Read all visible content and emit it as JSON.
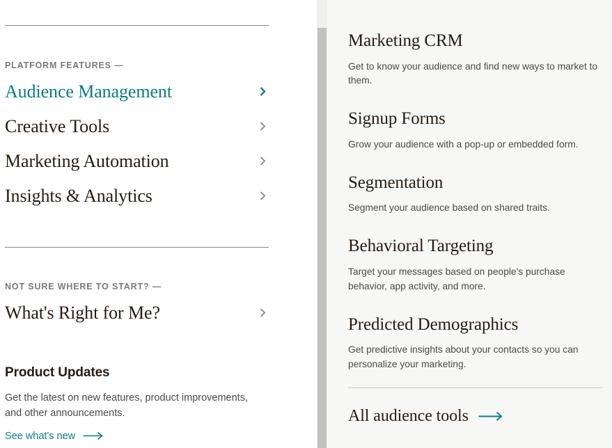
{
  "sidebar": {
    "sections": [
      {
        "eyebrow": "PLATFORM FEATURES —",
        "items": [
          {
            "label": "Audience Management",
            "active": true,
            "icon": "chevron-right-icon"
          },
          {
            "label": "Creative Tools",
            "active": false,
            "icon": "chevron-right-icon"
          },
          {
            "label": "Marketing Automation",
            "active": false,
            "icon": "chevron-right-icon"
          },
          {
            "label": "Insights & Analytics",
            "active": false,
            "icon": "chevron-right-icon"
          }
        ]
      },
      {
        "eyebrow": "NOT SURE WHERE TO START? —",
        "items": [
          {
            "label": "What's Right for Me?",
            "active": false,
            "icon": "chevron-right-icon"
          }
        ]
      }
    ],
    "product_updates": {
      "title": "Product Updates",
      "description": "Get the latest on new features, product improvements, and other announcements.",
      "link_label": "See what's new",
      "link_icon": "arrow-right-icon"
    }
  },
  "panel": {
    "features": [
      {
        "title": "Marketing CRM",
        "description": "Get to know your audience and find new ways to market to them."
      },
      {
        "title": "Signup Forms",
        "description": "Grow your audience with a pop-up or embedded form."
      },
      {
        "title": "Segmentation",
        "description": "Segment your audience based on shared traits."
      },
      {
        "title": "Behavioral Targeting",
        "description": "Target your messages based on people's purchase behavior, app activity, and more."
      },
      {
        "title": "Predicted Demographics",
        "description": "Get predictive insights about your contacts so you can personalize your marketing."
      }
    ],
    "footer_link": {
      "label": "All audience tools",
      "icon": "arrow-right-icon"
    }
  },
  "colors": {
    "accent_teal": "#0b7c86",
    "text_primary": "#241c15",
    "text_secondary": "#4a4a48",
    "eyebrow_gray": "#7a7a78",
    "panel_background": "#f7f7f5",
    "divider": "#868686",
    "scrollbar_thumb": "#c1c1c1"
  }
}
